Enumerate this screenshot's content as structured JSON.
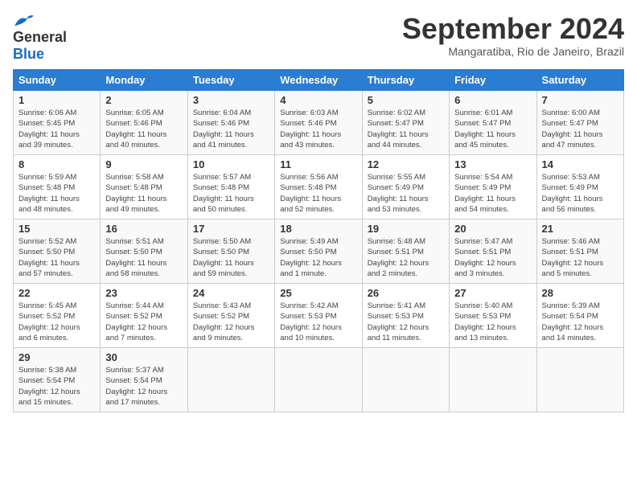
{
  "header": {
    "logo_line1": "General",
    "logo_line2": "Blue",
    "month": "September 2024",
    "location": "Mangaratiba, Rio de Janeiro, Brazil"
  },
  "days_of_week": [
    "Sunday",
    "Monday",
    "Tuesday",
    "Wednesday",
    "Thursday",
    "Friday",
    "Saturday"
  ],
  "weeks": [
    [
      {
        "num": "1",
        "info": "Sunrise: 6:06 AM\nSunset: 5:45 PM\nDaylight: 11 hours\nand 39 minutes."
      },
      {
        "num": "2",
        "info": "Sunrise: 6:05 AM\nSunset: 5:46 PM\nDaylight: 11 hours\nand 40 minutes."
      },
      {
        "num": "3",
        "info": "Sunrise: 6:04 AM\nSunset: 5:46 PM\nDaylight: 11 hours\nand 41 minutes."
      },
      {
        "num": "4",
        "info": "Sunrise: 6:03 AM\nSunset: 5:46 PM\nDaylight: 11 hours\nand 43 minutes."
      },
      {
        "num": "5",
        "info": "Sunrise: 6:02 AM\nSunset: 5:47 PM\nDaylight: 11 hours\nand 44 minutes."
      },
      {
        "num": "6",
        "info": "Sunrise: 6:01 AM\nSunset: 5:47 PM\nDaylight: 11 hours\nand 45 minutes."
      },
      {
        "num": "7",
        "info": "Sunrise: 6:00 AM\nSunset: 5:47 PM\nDaylight: 11 hours\nand 47 minutes."
      }
    ],
    [
      {
        "num": "8",
        "info": "Sunrise: 5:59 AM\nSunset: 5:48 PM\nDaylight: 11 hours\nand 48 minutes."
      },
      {
        "num": "9",
        "info": "Sunrise: 5:58 AM\nSunset: 5:48 PM\nDaylight: 11 hours\nand 49 minutes."
      },
      {
        "num": "10",
        "info": "Sunrise: 5:57 AM\nSunset: 5:48 PM\nDaylight: 11 hours\nand 50 minutes."
      },
      {
        "num": "11",
        "info": "Sunrise: 5:56 AM\nSunset: 5:48 PM\nDaylight: 11 hours\nand 52 minutes."
      },
      {
        "num": "12",
        "info": "Sunrise: 5:55 AM\nSunset: 5:49 PM\nDaylight: 11 hours\nand 53 minutes."
      },
      {
        "num": "13",
        "info": "Sunrise: 5:54 AM\nSunset: 5:49 PM\nDaylight: 11 hours\nand 54 minutes."
      },
      {
        "num": "14",
        "info": "Sunrise: 5:53 AM\nSunset: 5:49 PM\nDaylight: 11 hours\nand 56 minutes."
      }
    ],
    [
      {
        "num": "15",
        "info": "Sunrise: 5:52 AM\nSunset: 5:50 PM\nDaylight: 11 hours\nand 57 minutes."
      },
      {
        "num": "16",
        "info": "Sunrise: 5:51 AM\nSunset: 5:50 PM\nDaylight: 11 hours\nand 58 minutes."
      },
      {
        "num": "17",
        "info": "Sunrise: 5:50 AM\nSunset: 5:50 PM\nDaylight: 11 hours\nand 59 minutes."
      },
      {
        "num": "18",
        "info": "Sunrise: 5:49 AM\nSunset: 5:50 PM\nDaylight: 12 hours\nand 1 minute."
      },
      {
        "num": "19",
        "info": "Sunrise: 5:48 AM\nSunset: 5:51 PM\nDaylight: 12 hours\nand 2 minutes."
      },
      {
        "num": "20",
        "info": "Sunrise: 5:47 AM\nSunset: 5:51 PM\nDaylight: 12 hours\nand 3 minutes."
      },
      {
        "num": "21",
        "info": "Sunrise: 5:46 AM\nSunset: 5:51 PM\nDaylight: 12 hours\nand 5 minutes."
      }
    ],
    [
      {
        "num": "22",
        "info": "Sunrise: 5:45 AM\nSunset: 5:52 PM\nDaylight: 12 hours\nand 6 minutes."
      },
      {
        "num": "23",
        "info": "Sunrise: 5:44 AM\nSunset: 5:52 PM\nDaylight: 12 hours\nand 7 minutes."
      },
      {
        "num": "24",
        "info": "Sunrise: 5:43 AM\nSunset: 5:52 PM\nDaylight: 12 hours\nand 9 minutes."
      },
      {
        "num": "25",
        "info": "Sunrise: 5:42 AM\nSunset: 5:53 PM\nDaylight: 12 hours\nand 10 minutes."
      },
      {
        "num": "26",
        "info": "Sunrise: 5:41 AM\nSunset: 5:53 PM\nDaylight: 12 hours\nand 11 minutes."
      },
      {
        "num": "27",
        "info": "Sunrise: 5:40 AM\nSunset: 5:53 PM\nDaylight: 12 hours\nand 13 minutes."
      },
      {
        "num": "28",
        "info": "Sunrise: 5:39 AM\nSunset: 5:54 PM\nDaylight: 12 hours\nand 14 minutes."
      }
    ],
    [
      {
        "num": "29",
        "info": "Sunrise: 5:38 AM\nSunset: 5:54 PM\nDaylight: 12 hours\nand 15 minutes."
      },
      {
        "num": "30",
        "info": "Sunrise: 5:37 AM\nSunset: 5:54 PM\nDaylight: 12 hours\nand 17 minutes."
      },
      {
        "num": "",
        "info": ""
      },
      {
        "num": "",
        "info": ""
      },
      {
        "num": "",
        "info": ""
      },
      {
        "num": "",
        "info": ""
      },
      {
        "num": "",
        "info": ""
      }
    ]
  ]
}
